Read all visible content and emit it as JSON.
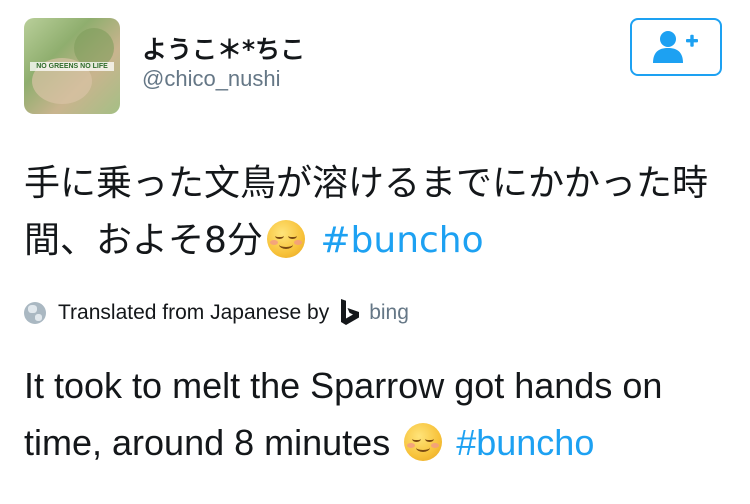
{
  "profile": {
    "display_name": "ようこ＊*ちこ",
    "handle": "@chico_nushi",
    "avatar_text": "NO GREENS NO LIFE"
  },
  "follow_button": {
    "icon": "add-user-icon"
  },
  "tweet": {
    "text": "手に乗った文鳥が溶けるまでにかかった時間、およそ8分",
    "emoji": "☺️",
    "hashtag": "#buncho"
  },
  "translation_bar": {
    "label": "Translated from Japanese by",
    "provider": "bing",
    "icon": "globe-icon"
  },
  "translation": {
    "text": "It took to melt the Sparrow got hands on time, around 8 minutes",
    "emoji": "☺️",
    "hashtag": "#buncho"
  },
  "colors": {
    "accent": "#1da1f2",
    "secondary_text": "#657786",
    "primary_text": "#14171a"
  }
}
